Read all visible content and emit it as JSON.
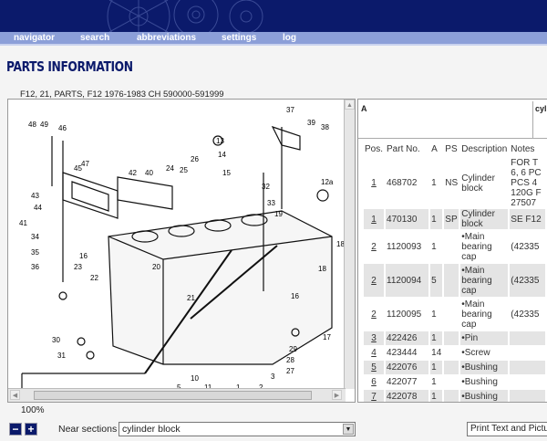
{
  "nav": {
    "items": [
      "navigator",
      "search",
      "abbreviations",
      "settings",
      "log"
    ]
  },
  "page_title": "PARTS INFORMATION",
  "breadcrumb": "F12, 21, PARTS, F12 1976-1983 CH 590000-591999",
  "diagram": {
    "zoom": "100%",
    "callouts": [
      "48",
      "49",
      "46",
      "47",
      "43",
      "44",
      "41",
      "34",
      "35",
      "36",
      "45",
      "42",
      "40",
      "24",
      "25",
      "26",
      "13",
      "14",
      "15",
      "37",
      "39",
      "38",
      "32",
      "33",
      "19",
      "12a",
      "18",
      "16",
      "23",
      "22",
      "20",
      "21",
      "18",
      "17",
      "16",
      "30",
      "31",
      "29",
      "28",
      "27",
      "3",
      "1",
      "2",
      "5",
      "10",
      "11"
    ]
  },
  "controls": {
    "zoom_out": "−",
    "zoom_in": "+",
    "near_sections_label": "Near sections",
    "near_sections_value": "cylinder block",
    "print_label": "Print Text and Pictu"
  },
  "info": {
    "col_a": "A",
    "col_cyl": "cyli"
  },
  "table": {
    "headers": [
      "Pos.",
      "Part No.",
      "A",
      "PS",
      "Description",
      "Notes"
    ],
    "rows": [
      {
        "pos": "1",
        "part": "468702",
        "a": "1",
        "ps": "NS",
        "desc": "Cylinder block",
        "notes": "FOR T 6, 6 PC PCS 4 120G F 27507"
      },
      {
        "pos": "1",
        "part": "470130",
        "a": "1",
        "ps": "SP",
        "desc": "Cylinder block",
        "notes": "SE F12"
      },
      {
        "pos": "2",
        "part": "1120093",
        "a": "1",
        "ps": "",
        "desc": "•Main bearing cap",
        "notes": "(42335"
      },
      {
        "pos": "2",
        "part": "1120094",
        "a": "5",
        "ps": "",
        "desc": "•Main bearing cap",
        "notes": "(42335"
      },
      {
        "pos": "2",
        "part": "1120095",
        "a": "1",
        "ps": "",
        "desc": "•Main bearing cap",
        "notes": "(42335"
      },
      {
        "pos": "3",
        "part": "422426",
        "a": "1",
        "ps": "",
        "desc": "•Pin",
        "notes": ""
      },
      {
        "pos": "4",
        "part": "423444",
        "a": "14",
        "ps": "",
        "desc": "•Screw",
        "notes": ""
      },
      {
        "pos": "5",
        "part": "422076",
        "a": "1",
        "ps": "",
        "desc": "•Bushing",
        "notes": ""
      },
      {
        "pos": "6",
        "part": "422077",
        "a": "1",
        "ps": "",
        "desc": "•Bushing",
        "notes": ""
      },
      {
        "pos": "7",
        "part": "422078",
        "a": "1",
        "ps": "",
        "desc": "•Bushing",
        "notes": ""
      }
    ]
  },
  "colors": {
    "header": "#0b1a6b",
    "nav": "#8c9fd8",
    "row_alt": "#e4e4e4"
  }
}
